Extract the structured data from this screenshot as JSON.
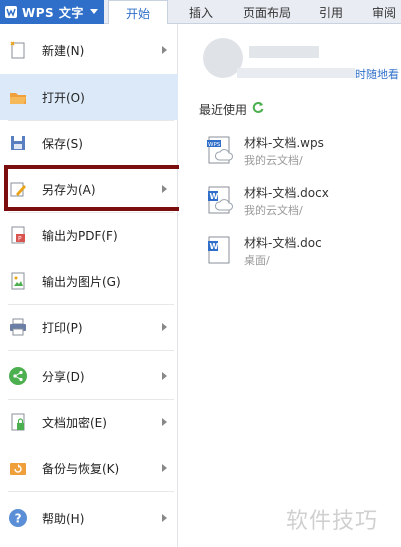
{
  "app": {
    "title": "WPS 文字"
  },
  "tabs": [
    "开始",
    "插入",
    "页面布局",
    "引用",
    "审阅"
  ],
  "menu": [
    {
      "label": "新建(N)",
      "icon": "new-doc-icon",
      "arrow": true
    },
    {
      "label": "打开(O)",
      "icon": "open-folder-icon",
      "arrow": false
    },
    {
      "label": "保存(S)",
      "icon": "save-icon",
      "arrow": false
    },
    {
      "label": "另存为(A)",
      "icon": "save-as-icon",
      "arrow": true
    },
    {
      "label": "输出为PDF(F)",
      "icon": "pdf-icon",
      "arrow": false
    },
    {
      "label": "输出为图片(G)",
      "icon": "image-export-icon",
      "arrow": false
    },
    {
      "label": "打印(P)",
      "icon": "print-icon",
      "arrow": true
    },
    {
      "label": "分享(D)",
      "icon": "share-icon",
      "arrow": true
    },
    {
      "label": "文档加密(E)",
      "icon": "encrypt-icon",
      "arrow": true
    },
    {
      "label": "备份与恢复(K)",
      "icon": "backup-icon",
      "arrow": true
    },
    {
      "label": "帮助(H)",
      "icon": "help-icon",
      "arrow": true
    }
  ],
  "account": {
    "link_text": "时随地看"
  },
  "recent": {
    "title": "最近使用",
    "files": [
      {
        "name": "材料-文档.wps",
        "path": "我的云文档/",
        "icon": "wps-file-icon"
      },
      {
        "name": "材料-文档.docx",
        "path": "我的云文档/",
        "icon": "docx-file-icon"
      },
      {
        "name": "材料-文档.doc",
        "path": "桌面/",
        "icon": "doc-file-icon"
      }
    ]
  },
  "watermark": "软件技巧",
  "colors": {
    "accent": "#2f6fc9",
    "highlight_border": "#7a0d0d",
    "hover_bg": "#dbe9f8"
  }
}
